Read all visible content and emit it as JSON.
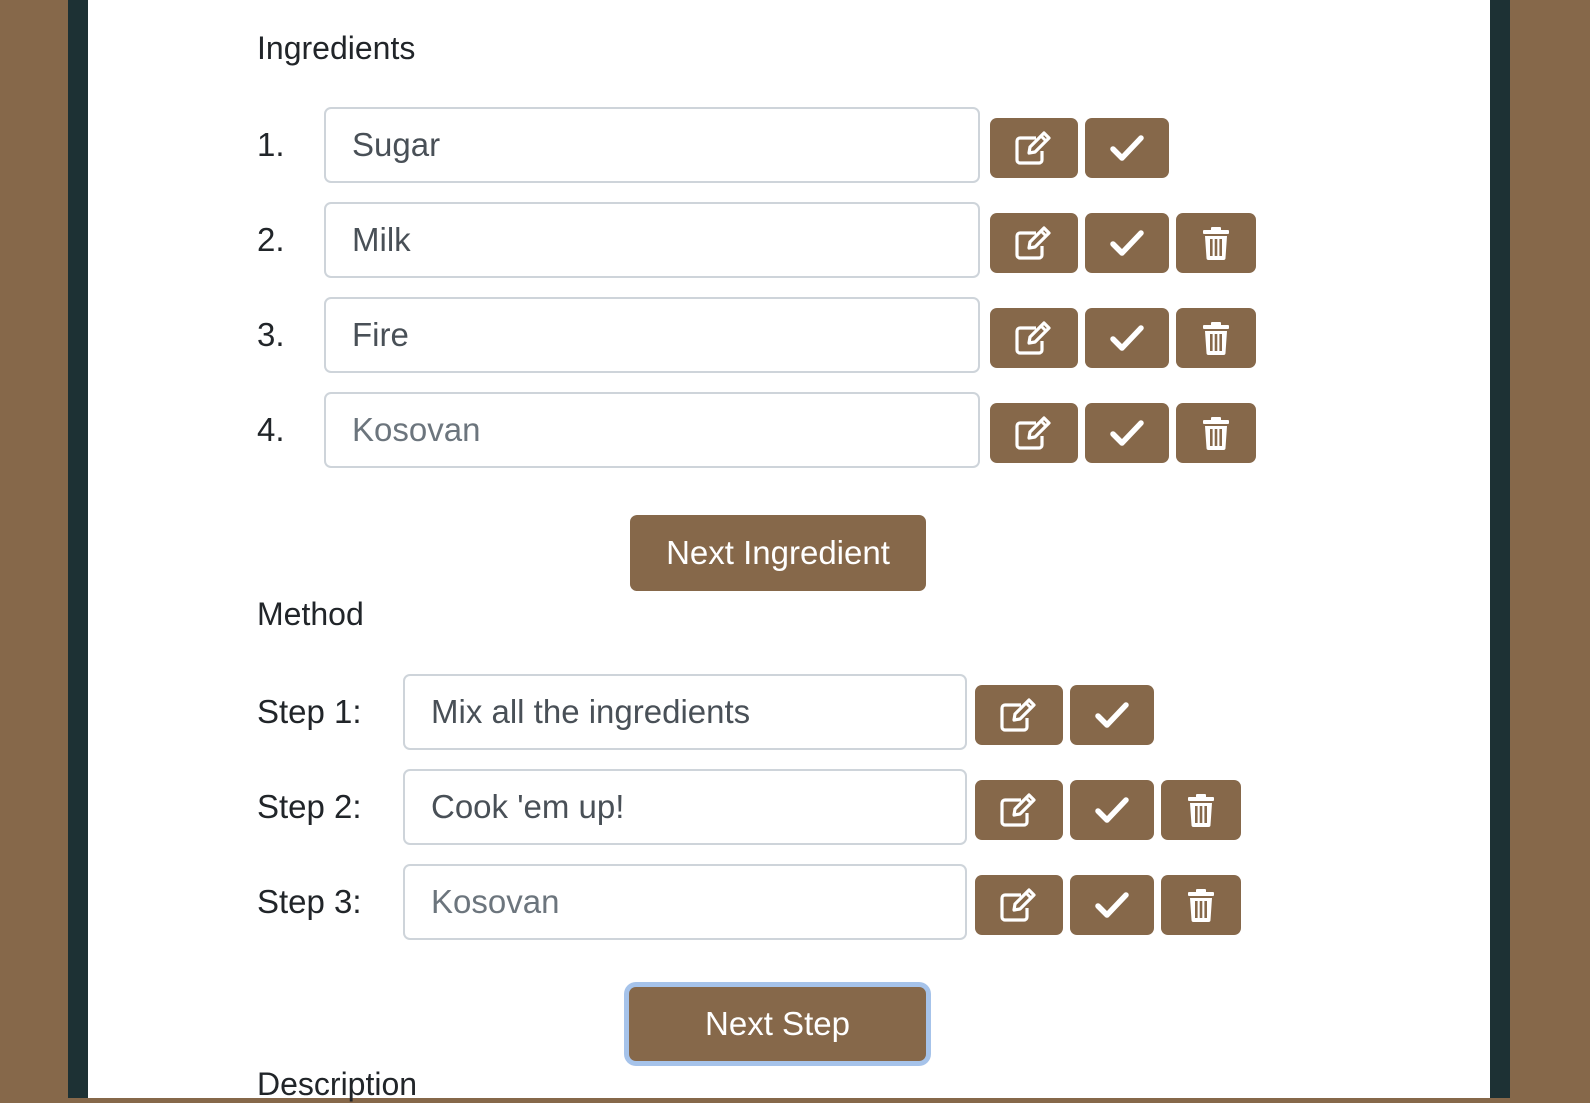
{
  "ingredients": {
    "title": "Ingredients",
    "items": [
      {
        "number": "1.",
        "value": "Sugar",
        "placeholder": "",
        "show_delete": false
      },
      {
        "number": "2.",
        "value": "Milk",
        "placeholder": "",
        "show_delete": true
      },
      {
        "number": "3.",
        "value": "Fire",
        "placeholder": "",
        "show_delete": true
      },
      {
        "number": "4.",
        "value": "",
        "placeholder": "Kosovan",
        "show_delete": true
      }
    ],
    "next_button_label": "Next Ingredient"
  },
  "method": {
    "title": "Method",
    "steps": [
      {
        "label": "Step 1:",
        "value": "Mix all the ingredients",
        "placeholder": "",
        "show_delete": false
      },
      {
        "label": "Step 2:",
        "value": "Cook 'em up!",
        "placeholder": "",
        "show_delete": true
      },
      {
        "label": "Step 3:",
        "value": "",
        "placeholder": "Kosovan",
        "show_delete": true
      }
    ],
    "next_button_label": "Next Step"
  },
  "description": {
    "title": "Description"
  },
  "icons": {
    "edit": "edit-icon",
    "confirm": "check-icon",
    "delete": "trash-icon"
  },
  "colors": {
    "background": "#86684a",
    "side_stripe": "#1d3134",
    "panel": "#ffffff",
    "button": "#86684a",
    "button_text": "#ffffff",
    "focus_ring": "#a6c3ea"
  }
}
